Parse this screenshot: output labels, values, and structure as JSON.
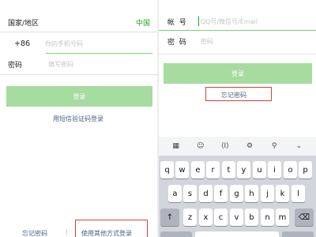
{
  "left": {
    "region_label": "国家/地区",
    "region_value": "中国",
    "country_code": "+86",
    "phone_placeholder": "你的手机号码",
    "password_label": "密码",
    "password_placeholder": "填写密码",
    "login_button": "登录",
    "sms_login_link": "用短信验证码登录",
    "forgot_password": "忘记密码",
    "divider": "|",
    "other_login": "使用其他方式登录"
  },
  "right": {
    "account_label": "帐  号",
    "account_placeholder": "QQ号/微信号/Email",
    "password_label": "密  码",
    "password_placeholder": "密码",
    "login_button": "登录",
    "forgot_password": "忘记密码"
  },
  "keyboard": {
    "toolbar": [
      {
        "name": "grid-icon",
        "glyph": "▦"
      },
      {
        "name": "emoji-icon",
        "glyph": "☺"
      },
      {
        "name": "cursor-icon",
        "glyph": "⟨I⟩"
      },
      {
        "name": "settings-icon",
        "glyph": "⚙"
      },
      {
        "name": "search-icon",
        "glyph": "⚲"
      },
      {
        "name": "collapse-icon",
        "glyph": "⌄"
      }
    ],
    "rows": [
      [
        "q",
        "w",
        "e",
        "r",
        "t",
        "y",
        "u",
        "i",
        "o",
        "p"
      ],
      [
        "a",
        "s",
        "d",
        "f",
        "g",
        "h",
        "j",
        "k",
        "l"
      ],
      [
        "↑",
        "z",
        "x",
        "c",
        "v",
        "b",
        "n",
        "m",
        "⌫"
      ]
    ]
  },
  "colors": {
    "accent_green": "#1aad19",
    "login_button_bg": "#a6dc9f",
    "link_blue": "#4a5f85",
    "highlight_red": "#d0453a",
    "keyboard_bg": "#d2d5db"
  }
}
